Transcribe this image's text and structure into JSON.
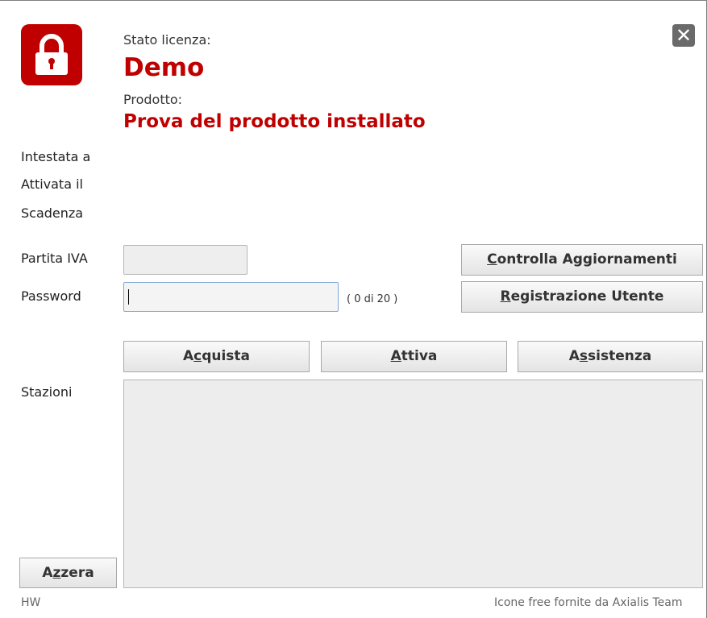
{
  "header": {
    "status_label": "Stato licenza:",
    "status_value": "Demo",
    "product_label": "Prodotto:",
    "product_value": "Prova del prodotto installato",
    "lock_icon": "lock-icon",
    "close_icon": "close-icon"
  },
  "info": {
    "intestata_label": "Intestata a",
    "attivata_label": "Attivata il",
    "scadenza_label": "Scadenza"
  },
  "form": {
    "partita_iva_label": "Partita IVA",
    "partita_iva_value": "",
    "password_label": "Password",
    "password_value": "",
    "password_counter": "( 0 di 20 )"
  },
  "buttons": {
    "controlla": {
      "pre": "",
      "mnemonic": "C",
      "post": "ontrolla Aggiornamenti"
    },
    "registrazione": {
      "pre": "",
      "mnemonic": "R",
      "post": "egistrazione Utente"
    },
    "acquista": {
      "pre": "A",
      "mnemonic": "c",
      "post": "quista"
    },
    "attiva": {
      "pre": "",
      "mnemonic": "A",
      "post": "ttiva"
    },
    "assistenza": {
      "pre": "A",
      "mnemonic": "s",
      "post": "sistenza"
    },
    "azzera": {
      "pre": "A",
      "mnemonic": "z",
      "post": "zera"
    }
  },
  "stations": {
    "label": "Stazioni",
    "items": []
  },
  "footer": {
    "left": "HW",
    "right": "Icone free fornite da Axialis Team"
  },
  "colors": {
    "accent": "#c00000",
    "close_button": "#6a6a6a"
  }
}
